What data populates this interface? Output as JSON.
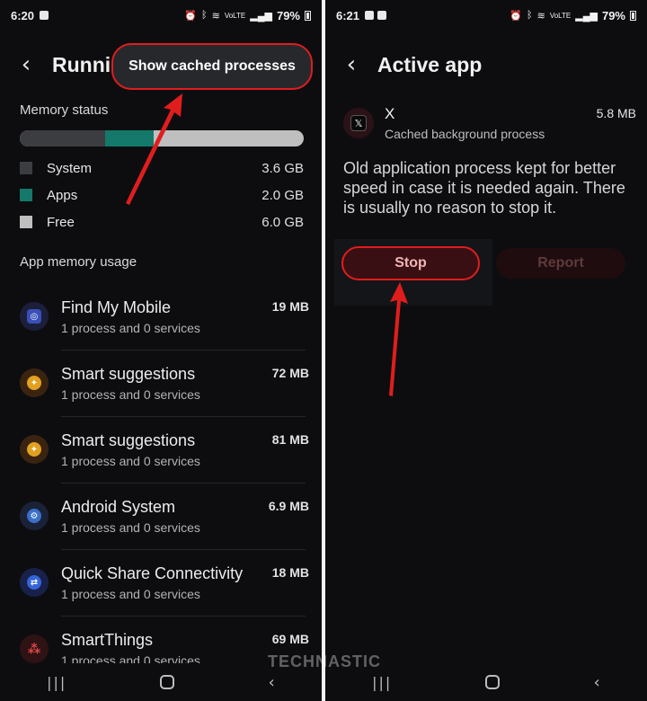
{
  "left": {
    "status": {
      "time": "6:20",
      "battery": "79%",
      "network": "VoLTE"
    },
    "title": "Runnin",
    "menu_item": "Show cached processes",
    "memory_status_label": "Memory status",
    "memory_bar": {
      "system_fraction": 0.3,
      "apps_fraction": 0.17,
      "free_fraction": 0.53
    },
    "legend": [
      {
        "label": "System",
        "value": "3.6 GB",
        "color": "#3c3d40"
      },
      {
        "label": "Apps",
        "value": "2.0 GB",
        "color": "#14796a"
      },
      {
        "label": "Free",
        "value": "6.0 GB",
        "color": "#bfbfbf"
      }
    ],
    "app_memory_label": "App memory usage",
    "apps": [
      {
        "name": "Find My Mobile",
        "sub": "1 process and 0 services",
        "size": "19 MB",
        "icon": "find-my-mobile-icon",
        "color": "#3a50b8"
      },
      {
        "name": "Smart suggestions",
        "sub": "1 process and 0 services",
        "size": "72 MB",
        "icon": "lightbulb-icon",
        "color": "#e2a020"
      },
      {
        "name": "Smart suggestions",
        "sub": "1 process and 0 services",
        "size": "81 MB",
        "icon": "lightbulb-icon",
        "color": "#e2a020"
      },
      {
        "name": "Android System",
        "sub": "1 process and 0 services",
        "size": "6.9 MB",
        "icon": "gear-icon",
        "color": "#3a6fc8"
      },
      {
        "name": "Quick Share Connectivity",
        "sub": "1 process and 0 services",
        "size": "18 MB",
        "icon": "quick-share-icon",
        "color": "#3464d8"
      },
      {
        "name": "SmartThings",
        "sub": "1 process and 0 services",
        "size": "69 MB",
        "icon": "smartthings-icon",
        "color": "#e04646"
      }
    ]
  },
  "right": {
    "status": {
      "time": "6:21",
      "battery": "79%",
      "network": "VoLTE"
    },
    "title": "Active app",
    "app": {
      "name": "X",
      "subtitle": "Cached background process",
      "size": "5.8 MB",
      "icon": "x-app-icon"
    },
    "description": "Old application process kept for better speed in case it is needed again. There is usually no reason to stop it.",
    "stop_label": "Stop",
    "report_label": "Report"
  },
  "watermark": "TECHNASTIC",
  "accent": "#e01d1d"
}
